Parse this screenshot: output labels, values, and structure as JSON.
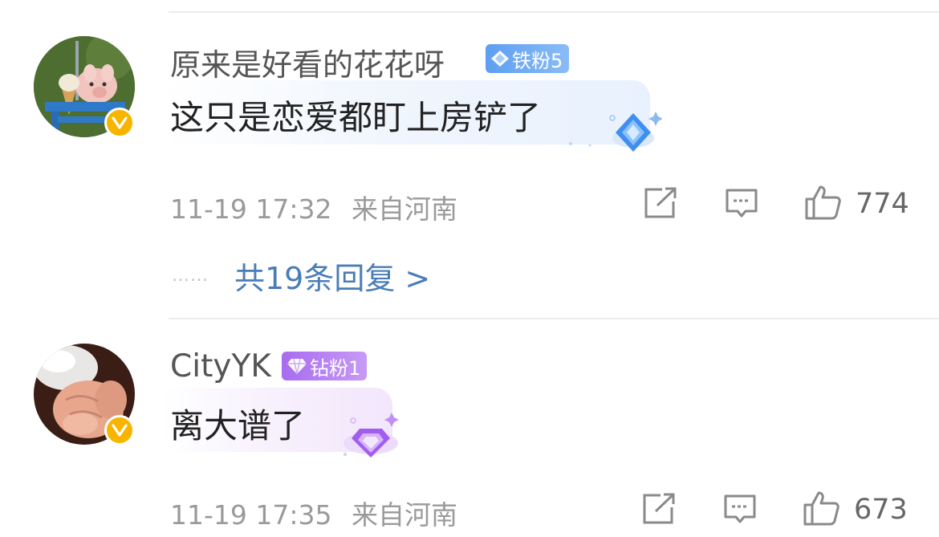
{
  "comments": [
    {
      "username": "原来是好看的花花呀",
      "fan_badge": "铁粉5",
      "text": "这只是恋爱都盯上房铲了",
      "time": "11-19 17:32",
      "location": "来自河南",
      "likes": "774",
      "replies_label": "共19条回复 >",
      "avatar": "pig-avatar",
      "badge_color": "#6fa6ee"
    },
    {
      "username": "CityYK",
      "fan_badge": "钻粉1",
      "text": "离大谱了",
      "time": "11-19 17:35",
      "location": "来自河南",
      "likes": "673",
      "avatar": "hand-avatar",
      "badge_color": "#b67bf0"
    }
  ],
  "replies_dots": "……",
  "colors": {
    "verified": "#f7b500",
    "link": "#4a7db8",
    "meta": "#9a9a9a"
  }
}
